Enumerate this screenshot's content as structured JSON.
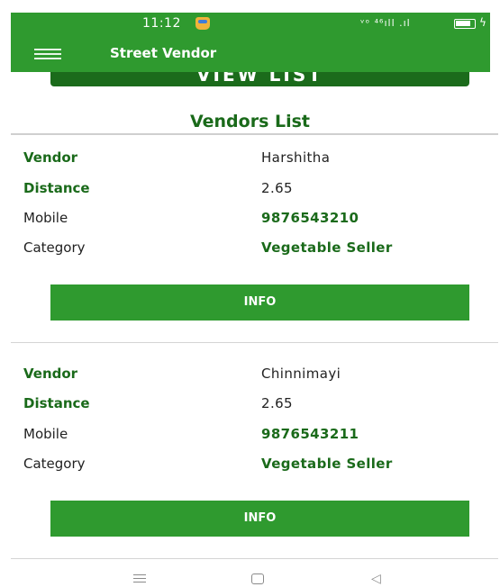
{
  "status_bar": {
    "time": "11:12",
    "signal_text": "ᵛᵒ ⁴⁶ıll .ıl"
  },
  "app_bar": {
    "title": "Street Vendor"
  },
  "view_list_button": {
    "label": "VIEW LIST"
  },
  "list_title": "Vendors List",
  "labels": {
    "vendor": "Vendor",
    "distance": "Distance",
    "mobile": "Mobile",
    "category": "Category",
    "info_button": "INFO"
  },
  "vendors": [
    {
      "name": "Harshitha",
      "distance": "2.65",
      "mobile": "9876543210",
      "category": "Vegetable Seller"
    },
    {
      "name": "Chinnimayi",
      "distance": "2.65",
      "mobile": "9876543211",
      "category": "Vegetable Seller"
    }
  ],
  "colors": {
    "primary": "#2f9a2f",
    "dark_green_text": "#1a6a1a"
  },
  "icons": [
    "menu-icon",
    "battery-icon",
    "nav-recent-icon",
    "nav-home-icon",
    "nav-back-icon"
  ]
}
